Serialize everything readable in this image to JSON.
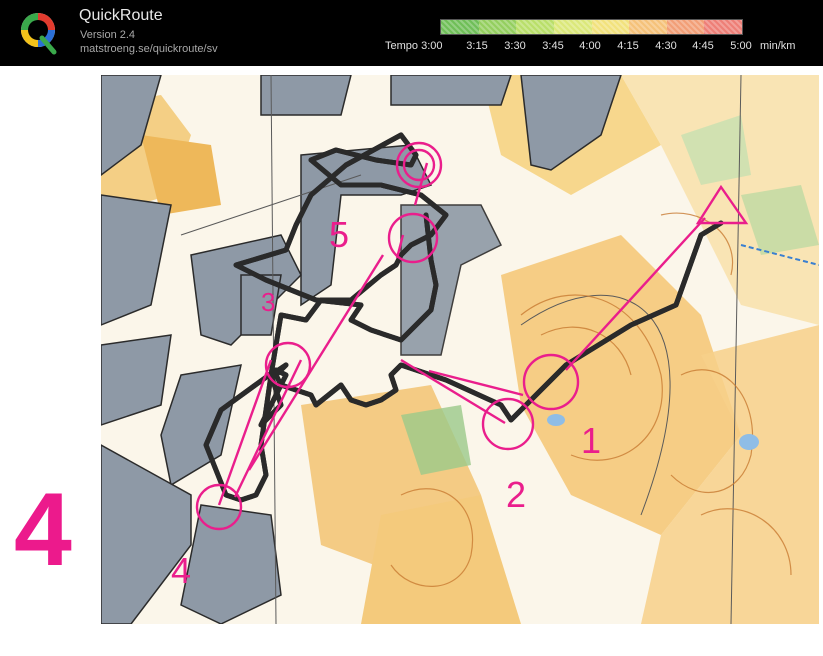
{
  "app": {
    "title": "QuickRoute",
    "version": "Version 2.4",
    "url": "matstroeng.se/quickroute/sv",
    "logo_letter": "Q"
  },
  "pace_scale": {
    "label": "Tempo 3:00",
    "ticks": [
      "3:15",
      "3:30",
      "3:45",
      "4:00",
      "4:15",
      "4:30",
      "4:45",
      "5:00"
    ],
    "unit": "min/km",
    "colors": [
      "#6fbf58",
      "#94cf5f",
      "#b9df6a",
      "#dbe87a",
      "#f2e27d",
      "#f5c27a",
      "#f29f77",
      "#ee7f77"
    ]
  },
  "map": {
    "control_numbers": [
      "1",
      "2",
      "3",
      "4",
      "5"
    ],
    "course_color": "#ea1e8c"
  },
  "leg_number": "4"
}
